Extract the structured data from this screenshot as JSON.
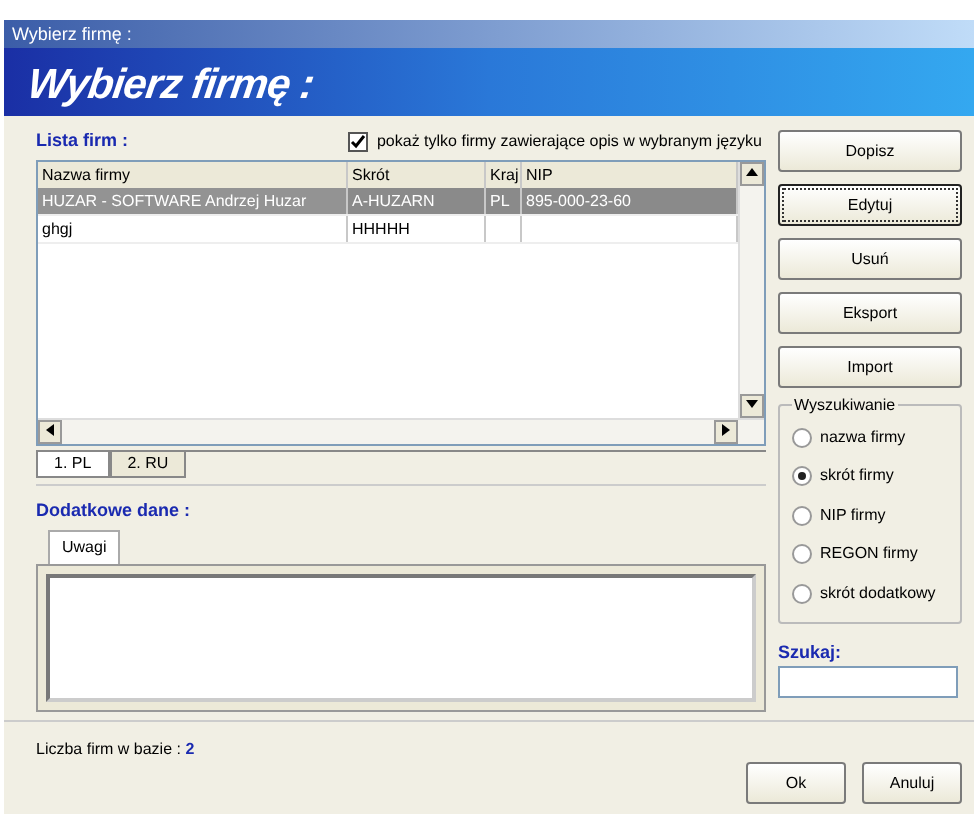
{
  "window": {
    "title": "Wybierz firmę :"
  },
  "banner": {
    "title": "Wybierz firmę :"
  },
  "company_list": {
    "label": "Lista firm :",
    "filter": {
      "label": "pokaż tylko firmy zawierające opis w wybranym języku",
      "checked": true
    },
    "columns": [
      "Nazwa firmy",
      "Skrót",
      "Kraj",
      "NIP"
    ],
    "rows": [
      {
        "cells": [
          "HUZAR - SOFTWARE  Andrzej Huzar",
          "A-HUZARN",
          "PL",
          "895-000-23-60"
        ],
        "selected": true
      },
      {
        "cells": [
          "ghgj",
          "HHHHH",
          "",
          ""
        ],
        "selected": false
      }
    ],
    "tabs": [
      {
        "label": "1. PL",
        "selected": true
      },
      {
        "label": "2. RU",
        "selected": false
      }
    ]
  },
  "additional": {
    "label": "Dodatkowe dane :",
    "tabs": [
      {
        "label": "Uwagi",
        "selected": true
      }
    ]
  },
  "buttons": [
    "Dopisz",
    "Edytuj",
    "Usuń",
    "Eksport",
    "Import"
  ],
  "search": {
    "group_label": "Wyszukiwanie",
    "options": [
      {
        "label": "nazwa firmy",
        "selected": false
      },
      {
        "label": "skrót firmy",
        "selected": true
      },
      {
        "label": "NIP firmy",
        "selected": false
      },
      {
        "label": "REGON firmy",
        "selected": false
      },
      {
        "label": "skrót dodatkowy",
        "selected": false
      }
    ],
    "field_label": "Szukaj:"
  },
  "footer": {
    "count_label": "Liczba firm w bazie :",
    "count": "2",
    "buttons": [
      "Ok",
      "Anuluj"
    ]
  }
}
